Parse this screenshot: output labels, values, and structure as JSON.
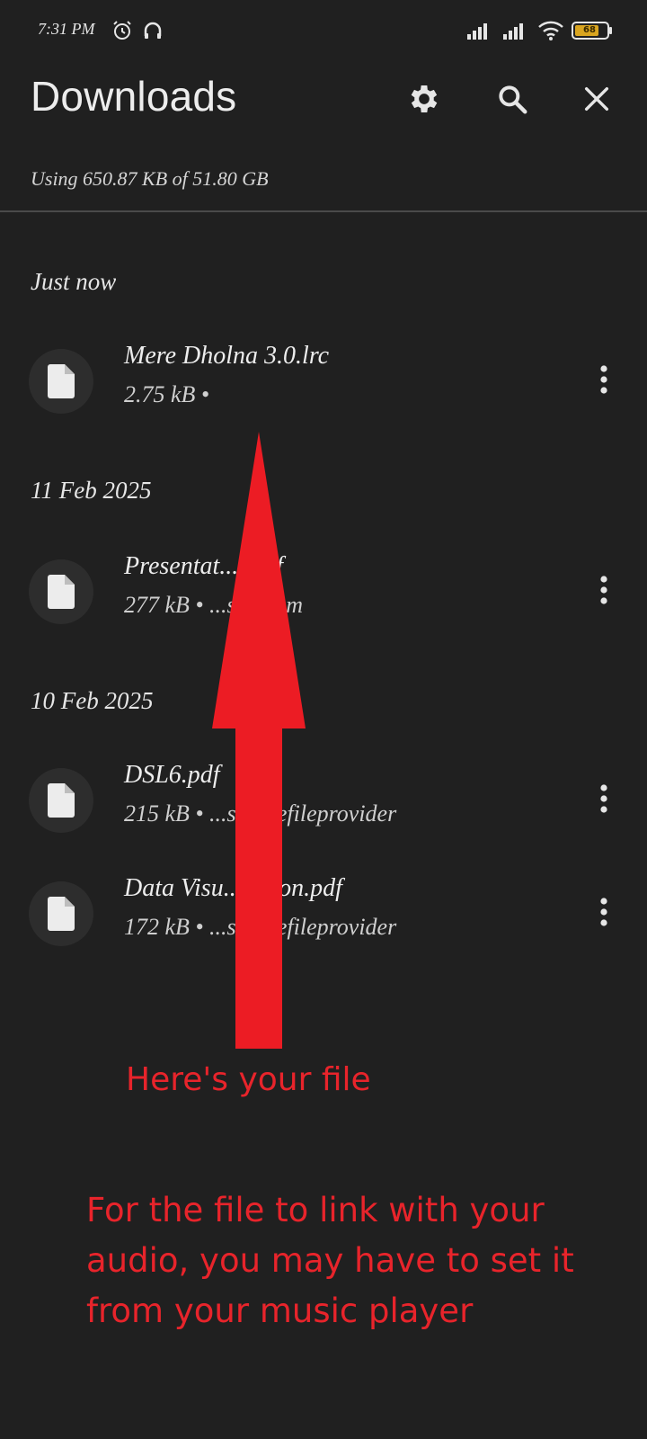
{
  "status_bar": {
    "time": "7:31 PM",
    "battery_level": "68",
    "icons": [
      "alarm-icon",
      "headphones-icon",
      "signal-icon",
      "signal-icon",
      "wifi-icon",
      "battery-icon"
    ]
  },
  "header": {
    "title": "Downloads",
    "icons": [
      "gear-icon",
      "search-icon",
      "close-icon"
    ]
  },
  "storage": {
    "text": "Using 650.87 KB of 51.80 GB"
  },
  "sections": [
    {
      "heading": "Just now",
      "files": [
        {
          "name": "Mere Dholna 3.0.lrc",
          "meta": "2.75 kB •"
        }
      ]
    },
    {
      "heading": "11 Feb 2025",
      "files": [
        {
          "name": "Presentat... .pdf",
          "meta": "277 kB • ...sbx.com"
        }
      ]
    },
    {
      "heading": "10 Feb 2025",
      "files": [
        {
          "name": "DSL6.pdf",
          "meta": "215 kB • ...securefileprovider"
        },
        {
          "name": "Data Visu...zation.pdf",
          "meta": "172 kB • ...securefileprovider"
        }
      ]
    }
  ],
  "annotation": {
    "caption": "Here's your file",
    "note": "For the file to link with your audio, you may have to set it from your music player",
    "color": "#e8242b"
  },
  "colors": {
    "background": "#202020",
    "text": "#ededed",
    "accent": "#e8242b"
  }
}
